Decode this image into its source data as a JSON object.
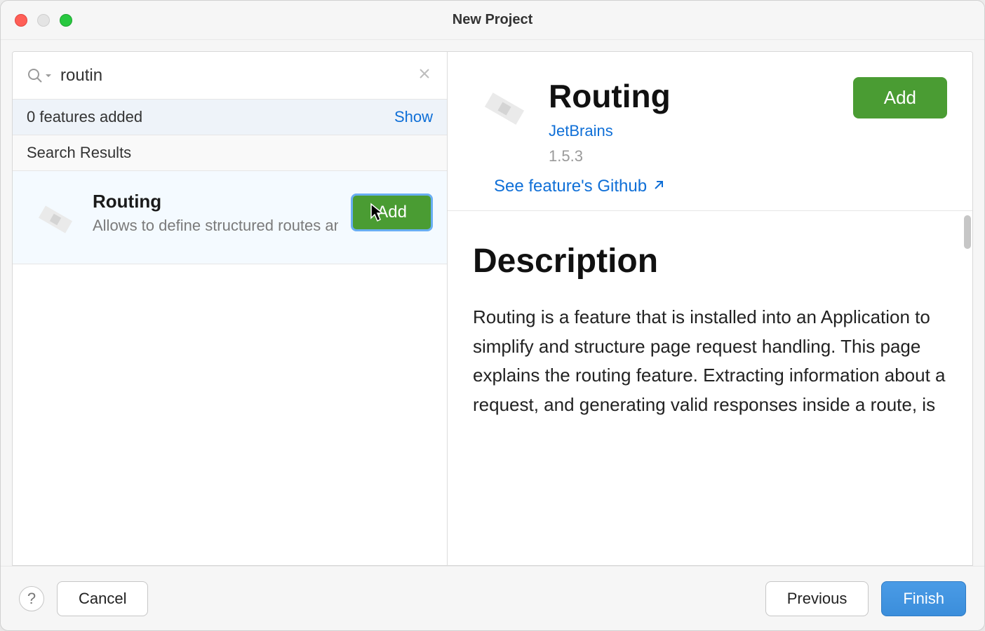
{
  "window": {
    "title": "New Project"
  },
  "sidebar": {
    "search_value": "routin",
    "features_added_label": "0 features added",
    "show_label": "Show",
    "search_results_label": "Search Results",
    "results": [
      {
        "title": "Routing",
        "description": "Allows to define structured routes and asso",
        "add_label": "Add"
      }
    ]
  },
  "detail": {
    "title": "Routing",
    "vendor": "JetBrains",
    "version": "1.5.3",
    "add_label": "Add",
    "github_label": "See feature's Github",
    "description_heading": "Description",
    "description_text": "Routing is a feature that is installed into an Application to simplify and structure page request handling. This page explains the routing feature. Extracting information about a request, and generating valid responses inside a route, is"
  },
  "footer": {
    "help_label": "?",
    "cancel_label": "Cancel",
    "previous_label": "Previous",
    "finish_label": "Finish"
  }
}
